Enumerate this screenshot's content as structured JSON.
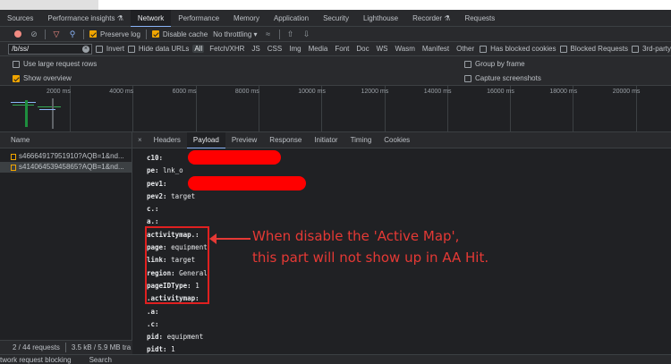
{
  "devtools_tabs": [
    "Sources",
    "Performance insights ⚗",
    "Network",
    "Performance",
    "Memory",
    "Application",
    "Security",
    "Lighthouse",
    "Recorder ⚗",
    "Requests"
  ],
  "active_tab": "Network",
  "toolbar": {
    "preserve_log": "Preserve log",
    "disable_cache": "Disable cache",
    "throttling": "No throttling"
  },
  "filter": {
    "value": "/b/ss/",
    "invert": "Invert",
    "hide_data_urls": "Hide data URLs",
    "types": [
      "All",
      "Fetch/XHR",
      "JS",
      "CSS",
      "Img",
      "Media",
      "Font",
      "Doc",
      "WS",
      "Wasm",
      "Manifest",
      "Other"
    ],
    "has_blocked_cookies": "Has blocked cookies",
    "blocked_requests": "Blocked Requests",
    "third_party": "3rd-party"
  },
  "options": {
    "large_rows": "Use large request rows",
    "group_by_frame": "Group by frame",
    "show_overview": "Show overview",
    "capture_screenshots": "Capture screenshots"
  },
  "timeline_ticks": [
    "2000 ms",
    "4000 ms",
    "6000 ms",
    "8000 ms",
    "10000 ms",
    "12000 ms",
    "14000 ms",
    "16000 ms",
    "18000 ms",
    "20000 ms"
  ],
  "requests_header": "Name",
  "requests": [
    "s46664917951910?AQB=1&nd...",
    "s41406453945865?AQB=1&nd..."
  ],
  "status": {
    "count": "2 / 44 requests",
    "size": "3.5 kB / 5.9 MB tra"
  },
  "detail_tabs": [
    "Headers",
    "Payload",
    "Preview",
    "Response",
    "Initiator",
    "Timing",
    "Cookies"
  ],
  "active_detail_tab": "Payload",
  "payload": [
    {
      "k": "c10:",
      "v": ""
    },
    {
      "k": "pe:",
      "v": "lnk_o"
    },
    {
      "k": "pev1:",
      "v": ""
    },
    {
      "k": "pev2:",
      "v": "target"
    },
    {
      "k": "c.:",
      "v": ""
    },
    {
      "k": "a.:",
      "v": ""
    },
    {
      "k": "activitymap.:",
      "v": ""
    },
    {
      "k": "page:",
      "v": "equipment"
    },
    {
      "k": "link:",
      "v": "target"
    },
    {
      "k": "region:",
      "v": "General"
    },
    {
      "k": "pageIDType:",
      "v": "1"
    },
    {
      "k": ".activitymap:",
      "v": ""
    },
    {
      "k": ".a:",
      "v": ""
    },
    {
      "k": ".c:",
      "v": ""
    },
    {
      "k": "pid:",
      "v": "equipment"
    },
    {
      "k": "pidt:",
      "v": "1"
    }
  ],
  "annotation": {
    "line1": "When disable the 'Active Map',",
    "line2": "this part will not show up in AA Hit."
  },
  "drawer_tabs": [
    "twork request blocking",
    "Search"
  ],
  "colors": {
    "accent": "#8ab4f8",
    "annotation": "#e53935",
    "checkbox": "#f0a500"
  }
}
